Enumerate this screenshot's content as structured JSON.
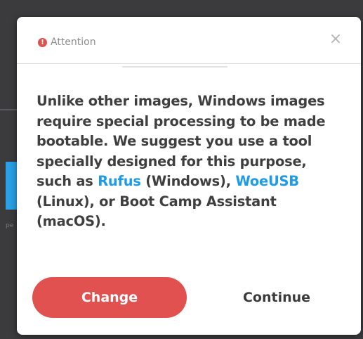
{
  "background": {
    "hint_text": "pe"
  },
  "dialog": {
    "header": {
      "icon": "exclamation-circle-icon",
      "title": "Attention",
      "close_icon": "close-icon",
      "close_glyph": "×"
    },
    "message": {
      "part1": "Unlike other images, Windows images require special processing to be made bootable. We suggest you use a tool specially designed for this purpose, such as ",
      "link1": "Rufus",
      "part2": " (Windows), ",
      "link2": "WoeUSB",
      "part3": " (Linux), or Boot Camp Assistant (macOS)."
    },
    "buttons": {
      "change_label": "Change",
      "continue_label": "Continue"
    }
  },
  "colors": {
    "accent_red": "#e0514f",
    "link_blue": "#1d9be8",
    "attention_red": "#d9534f",
    "backdrop": "#3b3b3e"
  }
}
